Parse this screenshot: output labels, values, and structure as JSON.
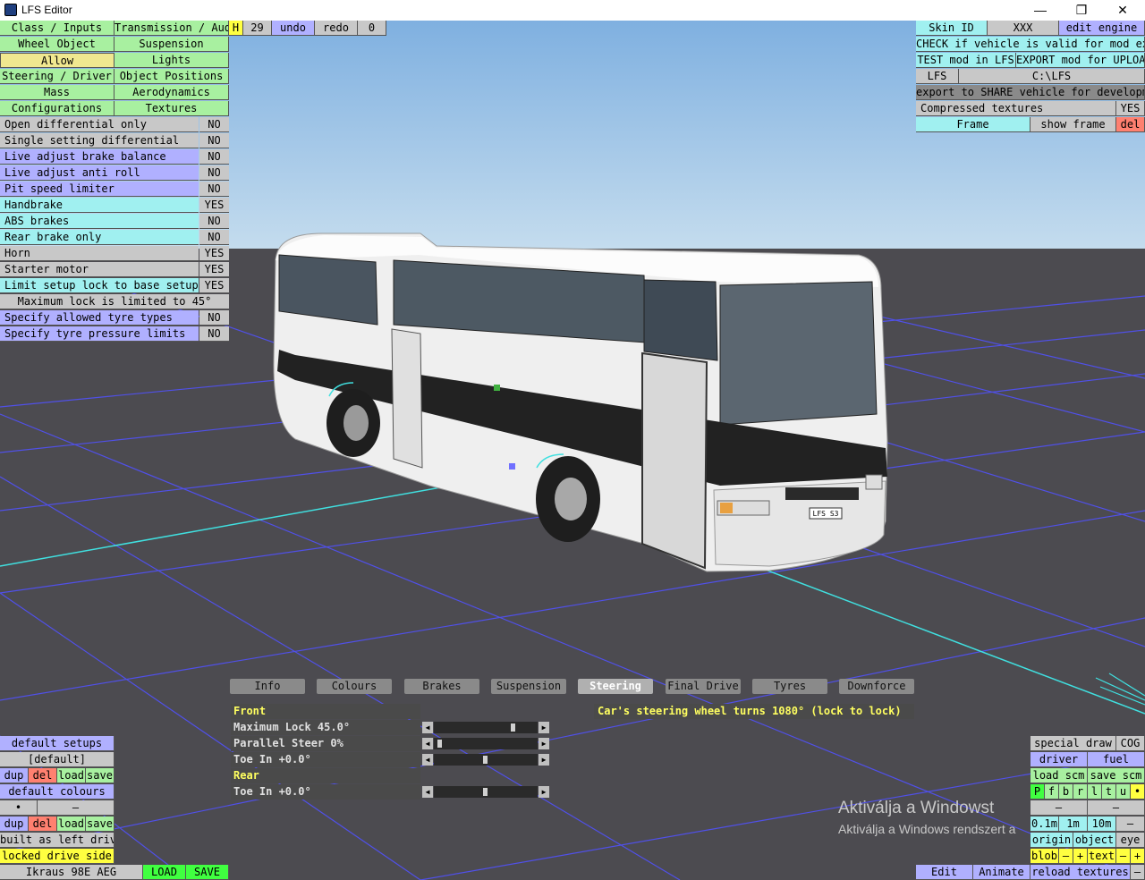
{
  "window": {
    "title": "LFS Editor",
    "min": "—",
    "max": "❐",
    "close": "✕"
  },
  "top_menu": {
    "class_inputs": "Class / Inputs",
    "transmission_audio": "Transmission / Audio",
    "wheel_object": "Wheel Object",
    "suspension": "Suspension",
    "allow": "Allow",
    "lights": "Lights",
    "steering_driver": "Steering / Driver",
    "object_positions": "Object Positions",
    "mass": "Mass",
    "aerodynamics": "Aerodynamics",
    "configurations": "Configurations",
    "textures": "Textures"
  },
  "toolbar": {
    "h": "H",
    "num": "29",
    "undo": "undo",
    "redo": "redo",
    "zero": "0"
  },
  "allow_rows": [
    {
      "label": "Open differential only",
      "value": "NO"
    },
    {
      "label": "Single setting differential",
      "value": "NO"
    },
    {
      "label": "Live adjust brake balance",
      "value": "NO"
    },
    {
      "label": "Live adjust anti roll",
      "value": "NO"
    },
    {
      "label": "Pit speed limiter",
      "value": "NO"
    },
    {
      "label": "Handbrake",
      "value": "YES"
    },
    {
      "label": "ABS brakes",
      "value": "NO"
    },
    {
      "label": "Rear brake only",
      "value": "NO"
    },
    {
      "label": "Horn",
      "value": "YES"
    },
    {
      "label": "Starter motor",
      "value": "YES"
    },
    {
      "label": "Limit setup lock to base setup lock",
      "value": "YES"
    },
    {
      "label": "Maximum lock is limited to 45°",
      "value": ""
    },
    {
      "label": "Specify allowed tyre types",
      "value": "NO"
    },
    {
      "label": "Specify tyre pressure limits",
      "value": "NO"
    }
  ],
  "right_panel": {
    "skin_id": "Skin ID",
    "xxx": "XXX",
    "edit_engine": "edit engine",
    "check_valid": "CHECK if vehicle is valid for mod export",
    "test_mod": "TEST mod in LFS",
    "export_mod": "EXPORT mod for UPLOAD",
    "lfs": "LFS",
    "lfs_path": "C:\\LFS",
    "export_share": "export to SHARE vehicle for development",
    "compressed": "Compressed textures",
    "compressed_val": "YES",
    "frame": "Frame",
    "show_frame": "show frame",
    "del": "del"
  },
  "tabs": [
    {
      "label": "Info"
    },
    {
      "label": "Colours"
    },
    {
      "label": "Brakes"
    },
    {
      "label": "Suspension"
    },
    {
      "label": "Steering"
    },
    {
      "label": "Final Drive"
    },
    {
      "label": "Tyres"
    },
    {
      "label": "Downforce"
    }
  ],
  "steering": {
    "front": "Front",
    "max_lock": "Maximum Lock 45.0°",
    "parallel": "Parallel Steer 0%",
    "toe_front": "Toe In +0.0°",
    "rear": "Rear",
    "toe_rear": "Toe In +0.0°",
    "info": "Car's steering wheel turns 1080° (lock to lock)",
    "sliders": {
      "max_lock": 0.8,
      "parallel": 0.0,
      "toe_front": 0.5,
      "toe_rear": 0.5
    }
  },
  "left_bottom": {
    "default_setups": "default setups",
    "default_val": "[default]",
    "dup": "dup",
    "del": "del",
    "load": "load",
    "save": "save",
    "default_colours": "default colours",
    "dot": "•",
    "dash": "–",
    "built_left": "built as left drive",
    "locked_side": "locked drive side",
    "vehicle": "Ikraus 98E AEG",
    "load_btn": "LOAD",
    "save_btn": "SAVE"
  },
  "right_bottom": {
    "special_draw": "special draw",
    "cog": "COG",
    "driver": "driver",
    "fuel": "fuel",
    "load_scm": "load scm",
    "save_scm": "save scm",
    "letters": [
      "P",
      "f",
      "b",
      "r",
      "l",
      "t",
      "u"
    ],
    "dot": "•",
    "dash": "–",
    "d01": "0.1m",
    "d1": "1m",
    "d10": "10m",
    "origin": "origin",
    "object": "object",
    "eye": "eye",
    "blob": "blob",
    "minus": "–",
    "plus": "+",
    "text": "text",
    "reload": "reload textures",
    "edit": "Edit",
    "animate": "Animate"
  },
  "watermark": {
    "line1": "Aktiválja a Windowst",
    "line2": "Aktiválja a Windows rendszert a"
  },
  "plate": "LFS S3"
}
